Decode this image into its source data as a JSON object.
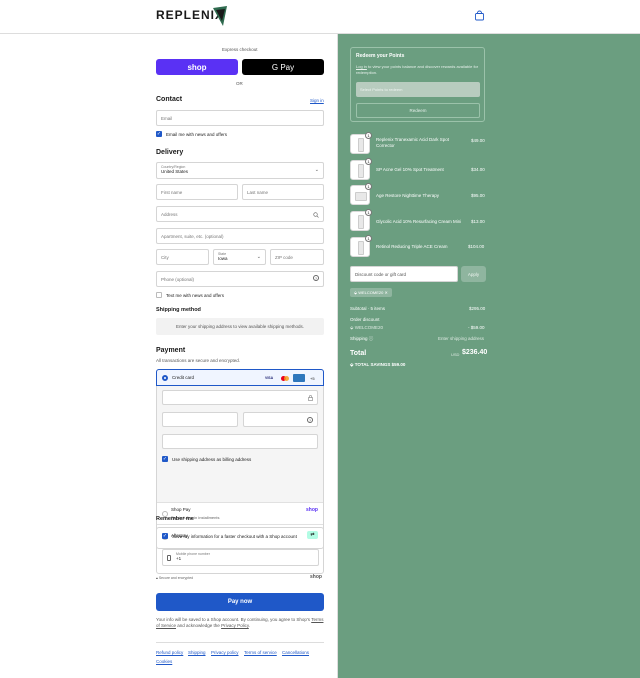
{
  "header": {
    "brand": "REPLENIX"
  },
  "express": {
    "label": "Express checkout",
    "shop_label": "shop",
    "gpay_label": "G Pay",
    "or": "OR"
  },
  "contact": {
    "title": "Contact",
    "signin": "Sign in",
    "email_placeholder": "Email",
    "email_news": "Email me with news and offers"
  },
  "delivery": {
    "title": "Delivery",
    "country_label": "Country/Region",
    "country_value": "United States",
    "first_name": "First name",
    "last_name": "Last name",
    "address": "Address",
    "apartment": "Apartment, suite, etc. (optional)",
    "city": "City",
    "state_label": "State",
    "state_value": "Iowa",
    "zip": "ZIP code",
    "phone": "Phone (optional)",
    "text_news": "Text me with news and offers"
  },
  "shipping": {
    "title": "Shipping method",
    "message": "Enter your shipping address to view available shipping methods."
  },
  "payment": {
    "title": "Payment",
    "subtitle": "All transactions are secure and encrypted.",
    "credit_card": "Credit card",
    "card_more": "+5",
    "billing_same": "Use shipping address as billing address",
    "shop_pay": "Shop Pay",
    "shop_pay_sub": "Pay in full or in installments",
    "shop_pay_logo": "shop",
    "afterpay": "Afterpay"
  },
  "remember": {
    "title": "Remember me",
    "save_info": "Save my information for a faster checkout with a Shop account",
    "mobile_label": "Mobile phone number",
    "mobile_value": "+1",
    "secure": "Secure and encrypted",
    "shop_logo": "shop"
  },
  "pay_now": "Pay now",
  "legal": {
    "text1": "Your info will be saved to a Shop account. By continuing, you agree to Shop's",
    "tos": "Terms of Service",
    "and": "and acknowledge the",
    "privacy": "Privacy Policy",
    "period": "."
  },
  "footer_links": [
    "Refund policy",
    "Shipping",
    "Privacy policy",
    "Terms of service",
    "Cancellations",
    "Cookies"
  ],
  "points": {
    "title": "Redeem your Points",
    "login": "Log in",
    "desc1": "to view your points balance and discover rewards",
    "desc2": "available for redemption.",
    "select": "Select Points to redeem",
    "redeem": "Redeem"
  },
  "items": [
    {
      "qty": "1",
      "name": "Replenix Tranexamic Acid Dark Spot Corrector",
      "price": "$49.00"
    },
    {
      "qty": "1",
      "name": "SP Acne Gel 10% Spot Treatment",
      "price": "$34.00"
    },
    {
      "qty": "1",
      "name": "Age Restore Nighttime Therapy",
      "price": "$95.00"
    },
    {
      "qty": "1",
      "name": "Glycolic Acid 10% Resurfacing Cream Mini",
      "price": "$13.00"
    },
    {
      "qty": "1",
      "name": "Retinol Reducing Triple ACE Cream",
      "price": "$104.00"
    }
  ],
  "discount": {
    "placeholder": "Discount code or gift card",
    "apply": "Apply",
    "tag": "WELCOME20"
  },
  "summary": {
    "subtotal_label": "Subtotal · 5 items",
    "subtotal_value": "$295.00",
    "order_discount": "Order discount",
    "code": "WELCOME20",
    "discount_value": "- $59.00",
    "shipping_label": "Shipping",
    "shipping_value": "Enter shipping address",
    "total_label": "Total",
    "currency": "USD",
    "total_value": "$236.40",
    "savings_label": "TOTAL SAVINGS",
    "savings_value": "$59.00"
  },
  "colors": {
    "accent": "#1f58c8",
    "shop": "#5a31f4",
    "sidebar": "#6b9e80"
  }
}
